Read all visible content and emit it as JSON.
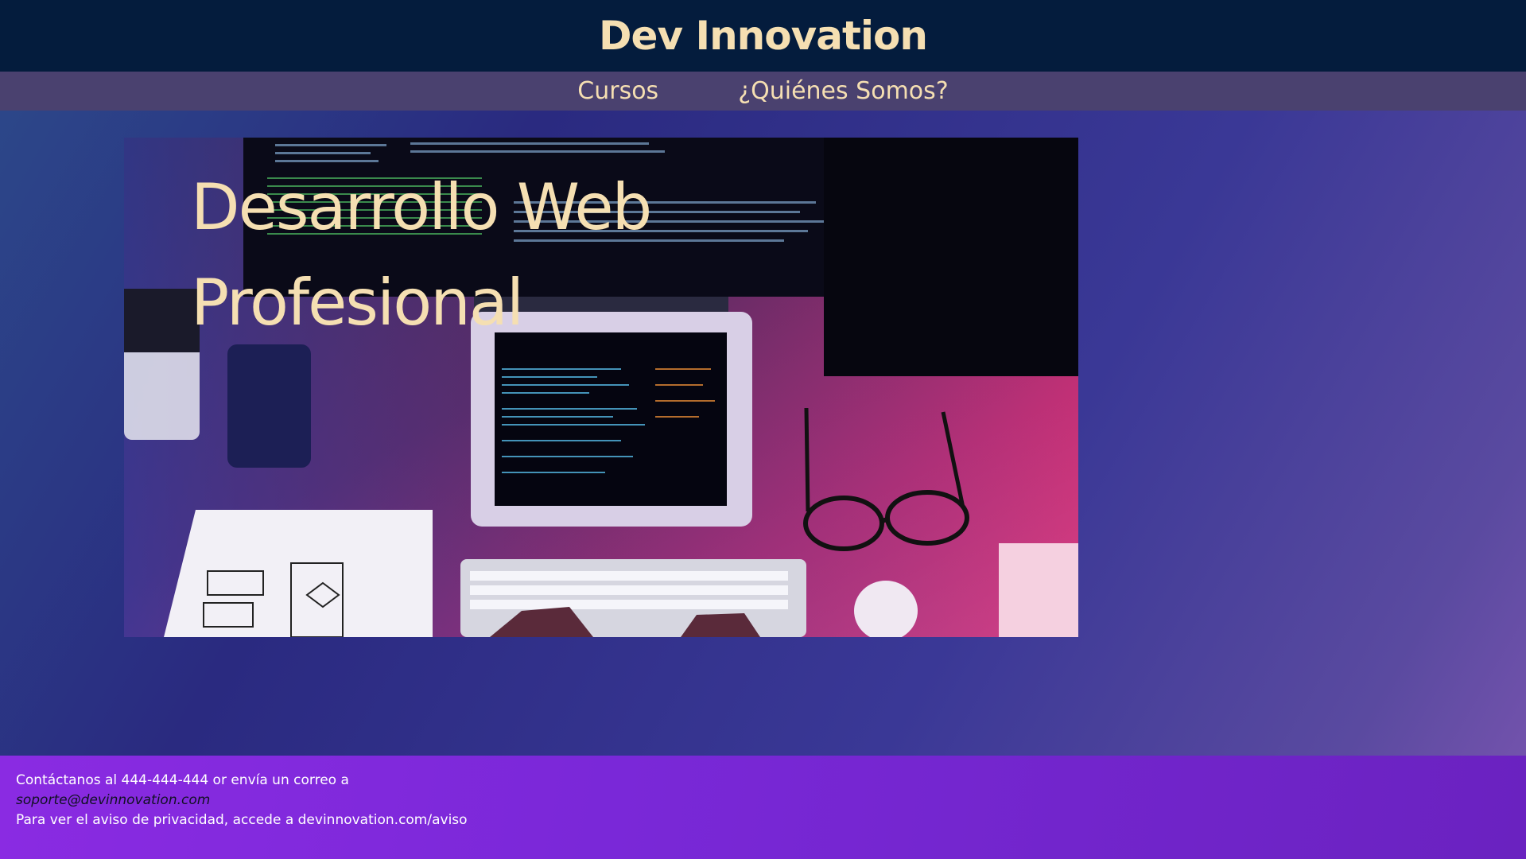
{
  "header": {
    "title": "Dev Innovation"
  },
  "nav": {
    "items": [
      {
        "label": "Cursos"
      },
      {
        "label": "¿Quiénes Somos?"
      }
    ]
  },
  "hero": {
    "heading": "Desarrollo Web Profesional",
    "image": "developer-desk-photo"
  },
  "footer": {
    "contact_text": "Contáctanos al 444-444-444 or envía un correo a",
    "email": "soporte@devinnovation.com",
    "privacy_text": "Para ver el aviso de privacidad, accede a devinnovation.com/aviso"
  },
  "colors": {
    "header_bg": "#041c3d",
    "nav_bg": "#4a416f",
    "accent_text": "#f5dfb2",
    "footer_bg": "#8a2be2"
  }
}
